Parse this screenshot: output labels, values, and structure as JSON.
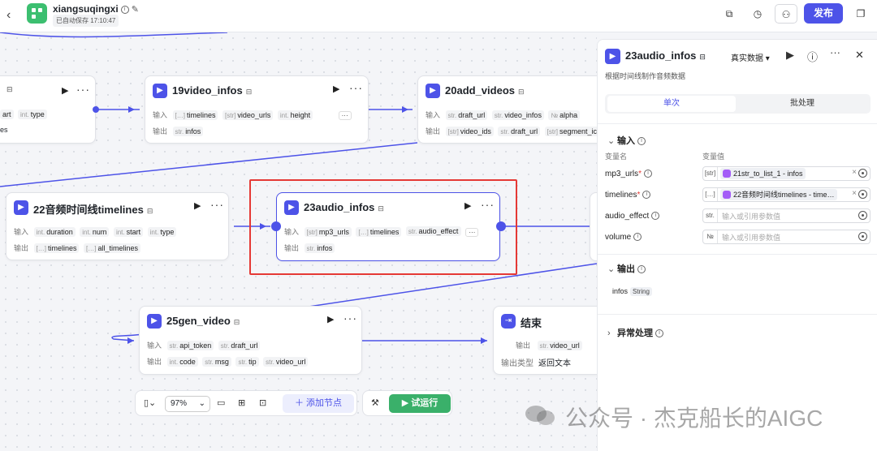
{
  "header": {
    "app_title": "xiangsuqingxi",
    "save_status": "已自动保存 17:10:47",
    "publish_label": "发布"
  },
  "nodes": {
    "n_left_top": {
      "in_params": [
        {
          "t": "art",
          "n": ""
        },
        {
          "t": "int.",
          "n": "type"
        }
      ],
      "out_params": [
        {
          "t": "es",
          "n": ""
        }
      ]
    },
    "n19": {
      "title": "19video_infos",
      "in_label": "输入",
      "out_label": "输出",
      "in_params": [
        {
          "t": "[…]",
          "n": "timelines"
        },
        {
          "t": "[str]",
          "n": "video_urls"
        },
        {
          "t": "int.",
          "n": "height"
        }
      ],
      "out_params": [
        {
          "t": "str.",
          "n": "infos"
        }
      ],
      "more": "···"
    },
    "n20": {
      "title": "20add_videos",
      "in_label": "输入",
      "out_label": "输出",
      "in_params": [
        {
          "t": "str.",
          "n": "draft_url"
        },
        {
          "t": "str.",
          "n": "video_infos"
        },
        {
          "t": "№",
          "n": "alpha"
        }
      ],
      "out_params": [
        {
          "t": "[str]",
          "n": "video_ids"
        },
        {
          "t": "str.",
          "n": "draft_url"
        },
        {
          "t": "[str]",
          "n": "segment_ic"
        }
      ]
    },
    "n22": {
      "title": "22音频时间线timelines",
      "in_label": "输入",
      "out_label": "输出",
      "in_params": [
        {
          "t": "int.",
          "n": "duration"
        },
        {
          "t": "int.",
          "n": "num"
        },
        {
          "t": "int.",
          "n": "start"
        },
        {
          "t": "int.",
          "n": "type"
        }
      ],
      "out_params": [
        {
          "t": "[…]",
          "n": "timelines"
        },
        {
          "t": "[…]",
          "n": "all_timelines"
        }
      ]
    },
    "n23": {
      "title": "23audio_infos",
      "in_label": "输入",
      "out_label": "输出",
      "in_params": [
        {
          "t": "[str]",
          "n": "mp3_urls"
        },
        {
          "t": "[…]",
          "n": "timelines"
        },
        {
          "t": "str.",
          "n": "audio_effect"
        }
      ],
      "out_params": [
        {
          "t": "str.",
          "n": "infos"
        }
      ],
      "more": "···"
    },
    "n25": {
      "title": "25gen_video",
      "in_label": "输入",
      "out_label": "输出",
      "in_params": [
        {
          "t": "str.",
          "n": "api_token"
        },
        {
          "t": "str.",
          "n": "draft_url"
        }
      ],
      "out_params": [
        {
          "t": "int.",
          "n": "code"
        },
        {
          "t": "str.",
          "n": "msg"
        },
        {
          "t": "str.",
          "n": "tip"
        },
        {
          "t": "str.",
          "n": "video_url"
        }
      ]
    },
    "end": {
      "title": "结束",
      "out_label": "输出",
      "out_params": [
        {
          "t": "str.",
          "n": "video_url"
        }
      ],
      "out_type_label": "输出类型",
      "out_type_value": "返回文本"
    }
  },
  "bottom": {
    "zoom": "97%",
    "add_node_label": "添加节点",
    "run_label": "试运行"
  },
  "panel": {
    "title": "23audio_infos",
    "description": "根据时间线制作音频数据",
    "data_source": "真实数据",
    "tab_single": "单次",
    "tab_batch": "批处理",
    "input_section": "输入",
    "col_name": "变量名",
    "col_value": "变量值",
    "inputs": [
      {
        "name": "mp3_urls",
        "required": "*",
        "type": "[str]",
        "value": "21str_to_list_1 - infos",
        "placeholder": ""
      },
      {
        "name": "timelines",
        "required": "*",
        "type": "[…]",
        "value": "22音频时间线timelines - time…",
        "placeholder": ""
      },
      {
        "name": "audio_effect",
        "required": "",
        "type": "str.",
        "value": "",
        "placeholder": "输入或引用参数值"
      },
      {
        "name": "volume",
        "required": "",
        "type": "№",
        "value": "",
        "placeholder": "输入或引用参数值"
      }
    ],
    "output_section": "输出",
    "output_name": "infos",
    "output_type": "String",
    "error_section": "异常处理"
  },
  "watermark": "公众号 · 杰克船长的AIGC",
  "colors": {
    "accent": "#4d53e8",
    "run": "#3ab06a",
    "highlight": "#e53935"
  }
}
